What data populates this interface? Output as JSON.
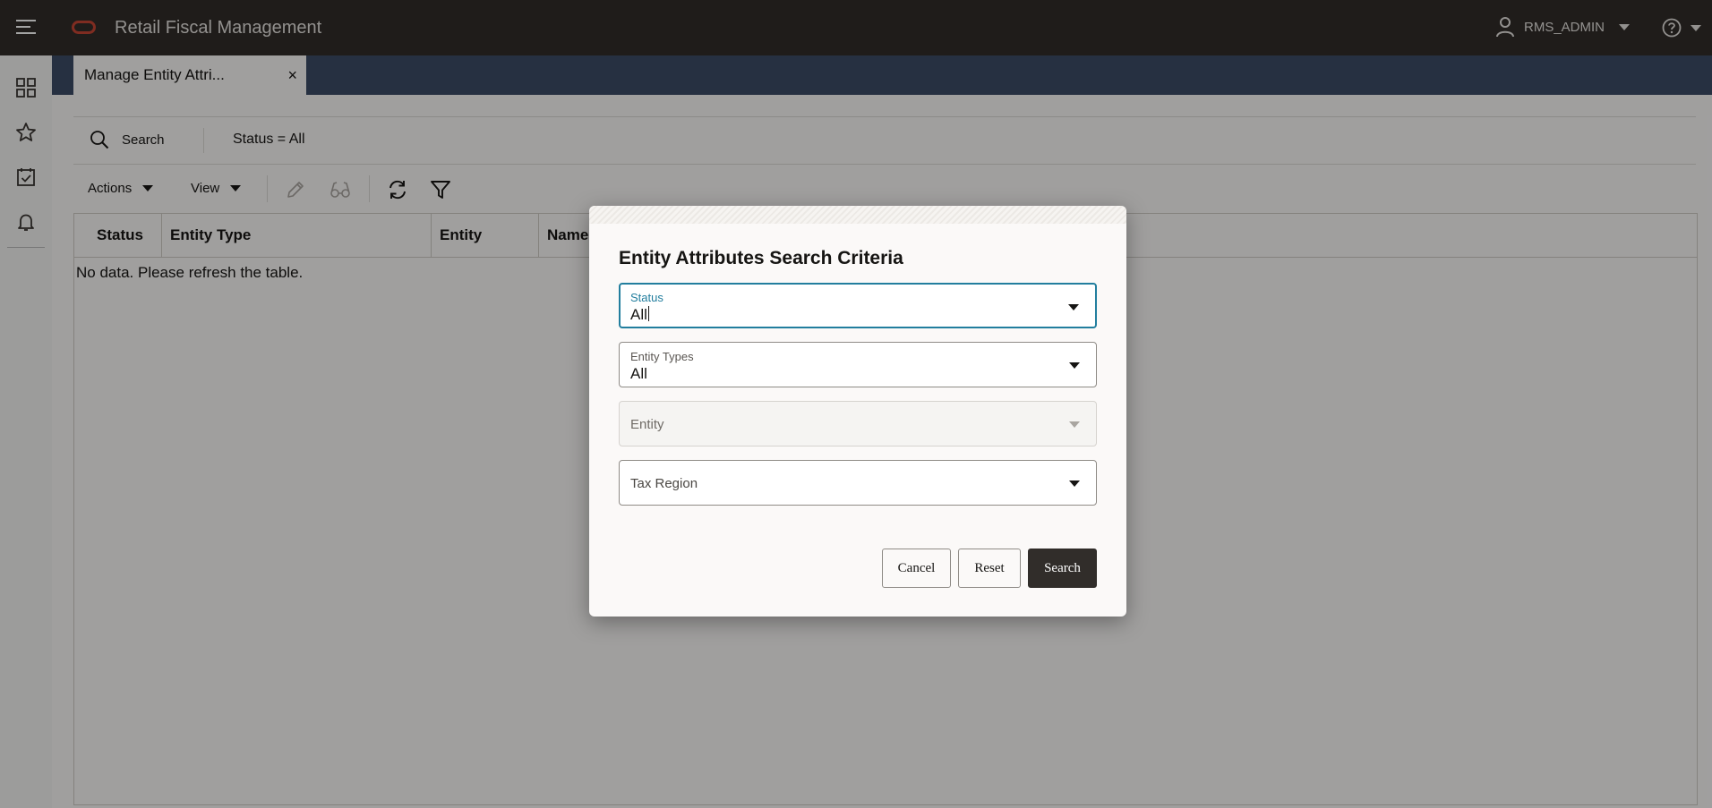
{
  "header": {
    "app_title": "Retail Fiscal Management",
    "user_name": "RMS_ADMIN"
  },
  "tabs": [
    {
      "label": "Manage Entity Attri...",
      "close": "×"
    }
  ],
  "search_bar": {
    "label": "Search",
    "summary": "Status = All"
  },
  "toolbar": {
    "actions_label": "Actions",
    "view_label": "View"
  },
  "table": {
    "columns": [
      "Status",
      "Entity Type",
      "Entity",
      "Name"
    ],
    "empty_message": "No data. Please refresh the table."
  },
  "dialog": {
    "title": "Entity Attributes Search Criteria",
    "fields": {
      "status": {
        "label": "Status",
        "value": "All"
      },
      "entity_types": {
        "label": "Entity Types",
        "value": "All"
      },
      "entity": {
        "label": "Entity"
      },
      "tax_region": {
        "label": "Tax Region"
      }
    },
    "buttons": {
      "cancel": "Cancel",
      "reset": "Reset",
      "search": "Search"
    }
  },
  "colors": {
    "topbar": "#312d2a",
    "tabstrip": "#3c4b66",
    "focus": "#227e9e",
    "brand": "#c74634"
  }
}
